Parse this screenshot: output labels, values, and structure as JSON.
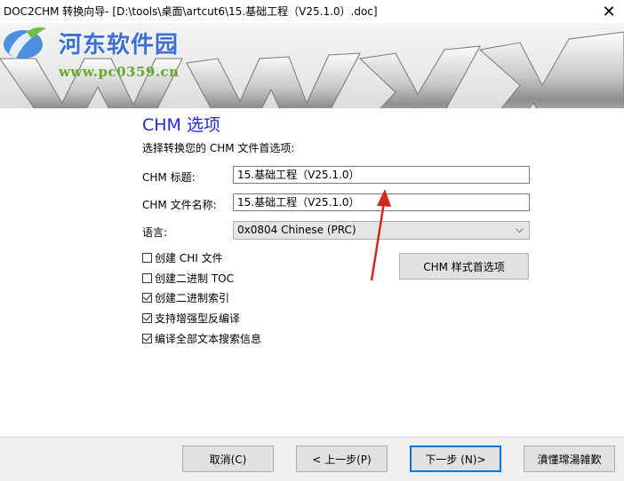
{
  "window": {
    "title": "DOC2CHM 转换向导- [D:\\tools\\桌面\\artcut6\\15.基础工程（V25.1.0）.doc]",
    "close_symbol": "✕"
  },
  "watermark": {
    "site_name": "河东软件园",
    "url": "www.pc0359.cn"
  },
  "page": {
    "heading": "CHM 选项",
    "subheading": "选择转换您的 CHM 文件首选项:"
  },
  "form": {
    "title_label": "CHM 标题:",
    "title_value": "15.基础工程（V25.1.0）",
    "filename_label": "CHM 文件名称:",
    "filename_value": "15.基础工程（V25.1.0）",
    "language_label": "语言:",
    "language_value": "0x0804 Chinese (PRC)",
    "language_chevron": "⌵"
  },
  "options": [
    {
      "label": "创建 CHI 文件",
      "checked": false
    },
    {
      "label": "创建二进制 TOC",
      "checked": false
    },
    {
      "label": "创建二进制索引",
      "checked": true
    },
    {
      "label": "支持增强型反编译",
      "checked": true
    },
    {
      "label": "编译全部文本搜索信息",
      "checked": true
    }
  ],
  "buttons": {
    "preferences": "CHM 样式首选项",
    "cancel": "取消(C)",
    "back": "< 上一步(P)",
    "next": "下一步 (N)>",
    "finish": "濆懂瑺湯雑歎"
  },
  "colors": {
    "heading": "#1f2bd6",
    "annotation_arrow": "#d9261c",
    "default_button_border": "#0078d7"
  }
}
